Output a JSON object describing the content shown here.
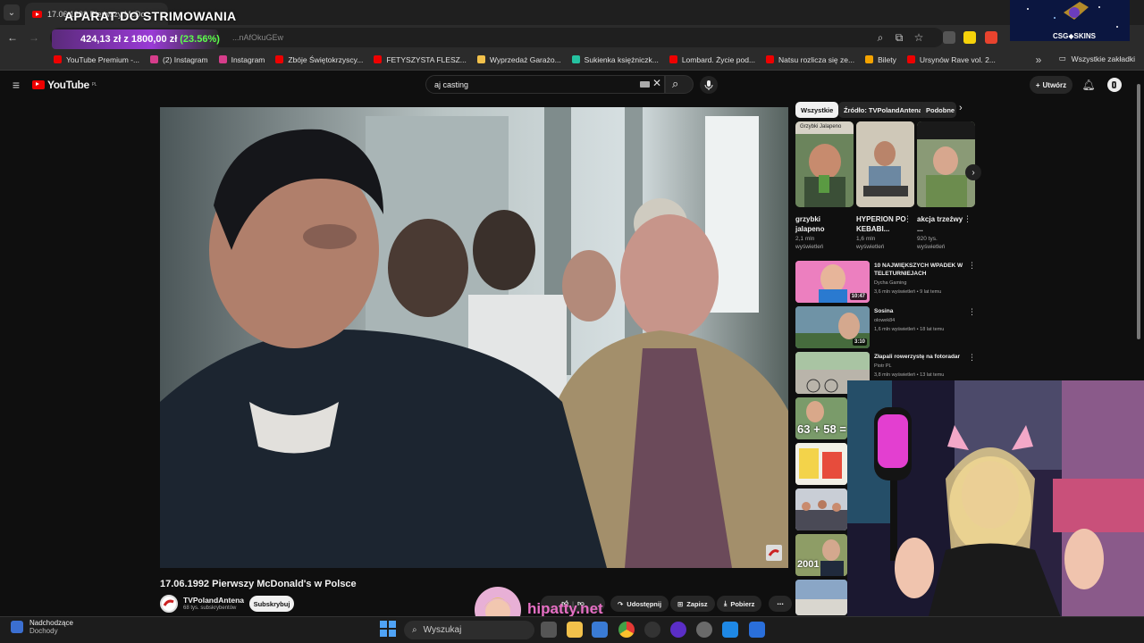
{
  "browser": {
    "tab_title": "17.06.1992 Pierwszy McDo...",
    "stream_overlay_title": "APARAT DO STRIMOWANIA",
    "url_fragment": "...nAfOkuGEw",
    "donation": {
      "amount": "424,13 zł z 1800,00 zł",
      "percent": "(23.56%)"
    },
    "bookmarks": [
      {
        "label": "YouTube Premium -...",
        "color": "#e00"
      },
      {
        "label": "(2) Instagram",
        "color": "#d63d8b"
      },
      {
        "label": "Instagram",
        "color": "#d63d8b"
      },
      {
        "label": "Zbóje Świętokrzyscy...",
        "color": "#e00"
      },
      {
        "label": "FETYSZYSTA FLESZ...",
        "color": "#e00"
      },
      {
        "label": "Wyprzedaż Garażo...",
        "color": "#f2c14b"
      },
      {
        "label": "Sukienka księżniczk...",
        "color": "#25c2a0"
      },
      {
        "label": "Lombard. Życie pod...",
        "color": "#e00"
      },
      {
        "label": "Natsu rozlicza się ze...",
        "color": "#e00"
      },
      {
        "label": "Bilety",
        "color": "#f4a300"
      },
      {
        "label": "Ursynów Rave vol. 2...",
        "color": "#e00"
      }
    ],
    "all_bookmarks": "Wszystkie zakładki"
  },
  "youtube": {
    "logo": "YouTube",
    "region": "PL",
    "search_value": "aj casting",
    "create_label": "Utwórz",
    "video_title": "17.06.1992 Pierwszy McDonald's w Polsce",
    "channel_name": "TVPolandAntena",
    "channel_subs": "68 tys. subskrybentów",
    "subscribe_label": "Subskrybuj",
    "share_label": "Udostępnij",
    "save_label": "Zapisz",
    "download_label": "Pobierz",
    "chips": [
      "Wszystkie",
      "Źródło: TVPolandAntena",
      "Podobne"
    ],
    "shorts": [
      {
        "title": "grzybki jalapeno",
        "views": "2,1 mln wyświetleń",
        "caption": "Grzybki Jalapeno"
      },
      {
        "title": "HYPERION PO KEBABI...",
        "views": "1,6 mln wyświetleń",
        "caption": ""
      },
      {
        "title": "akcja trzeźwy ...",
        "views": "920 tys. wyświetleń",
        "caption": ""
      }
    ],
    "recommendations": [
      {
        "title": "10 NAJWIĘKSZYCH WPADEK W TELETURNIEJACH",
        "channel": "Dycha Gaming",
        "meta": "3,6 mln wyświetleń • 9 lat temu",
        "duration": "10:47"
      },
      {
        "title": "Sosina",
        "channel": "olowek84",
        "meta": "1,6 mln wyświetleń • 18 lat temu",
        "duration": "3:10"
      },
      {
        "title": "Złapali rowerzystę na fotoradar",
        "channel": "Piotr PL",
        "meta": "3,8 mln wyświetleń • 13 lat temu",
        "duration": ""
      }
    ],
    "thumb_captions": [
      "63 + 58 =",
      "2001"
    ]
  },
  "overlays": {
    "csg_brand": "CSG",
    "csg_brand2": "SKINS",
    "hipatty": "hipatty.net"
  },
  "taskbar": {
    "news_title": "Nadchodzące",
    "news_sub": "Dochody",
    "search_label": "Wyszukaj"
  }
}
